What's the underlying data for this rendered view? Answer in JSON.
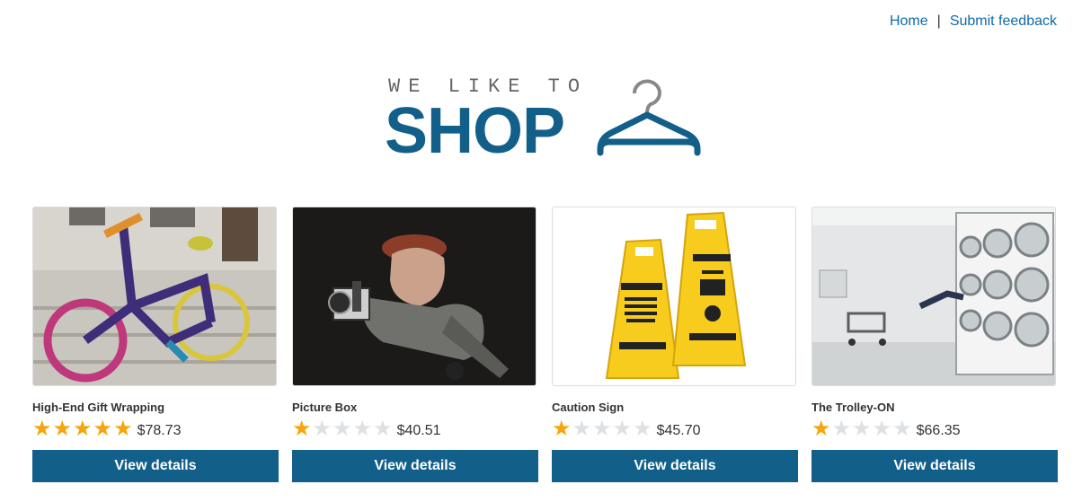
{
  "nav": {
    "home": "Home",
    "separator": "|",
    "feedback": "Submit feedback"
  },
  "logo": {
    "tagline": "WE LIKE TO",
    "word": "SHOP",
    "icon": "hanger-icon"
  },
  "colors": {
    "brand": "#125f8a",
    "link": "#0e6aa8",
    "star_on": "#f6a50e",
    "star_off": "#dde1e4"
  },
  "products": [
    {
      "name": "High-End Gift Wrapping",
      "rating": 5,
      "max_rating": 5,
      "price": "$78.73",
      "button": "View details",
      "image": "knitted-bicycle"
    },
    {
      "name": "Picture Box",
      "rating": 1,
      "max_rating": 5,
      "price": "$40.51",
      "button": "View details",
      "image": "photographer-figurine"
    },
    {
      "name": "Caution Sign",
      "rating": 1,
      "max_rating": 5,
      "price": "$45.70",
      "button": "View details",
      "image": "yellow-caution-signs"
    },
    {
      "name": "The Trolley-ON",
      "rating": 1,
      "max_rating": 5,
      "price": "$66.35",
      "button": "View details",
      "image": "laundromat"
    }
  ]
}
